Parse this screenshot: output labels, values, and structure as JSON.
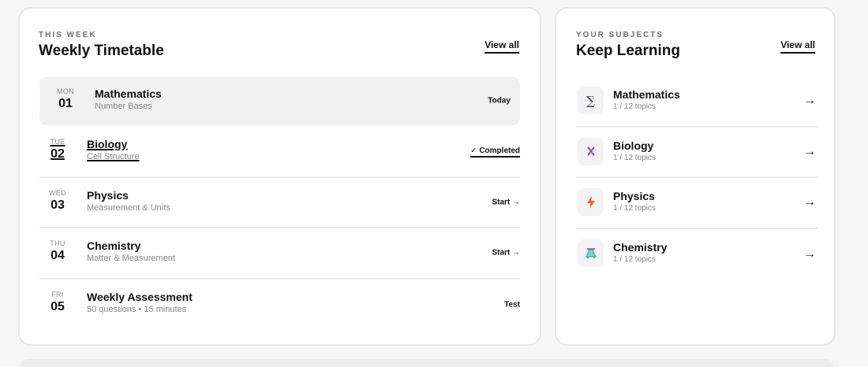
{
  "timetable": {
    "eyebrow": "THIS WEEK",
    "title": "Weekly Timetable",
    "view_all": "View all",
    "rows": [
      {
        "dow": "MON",
        "num": "01",
        "subject": "Mathematics",
        "topic": "Number Bases",
        "action": "Today"
      },
      {
        "dow": "TUE",
        "num": "02",
        "subject": "Biology",
        "topic": "Cell Structure",
        "action": "✓ Completed"
      },
      {
        "dow": "WED",
        "num": "03",
        "subject": "Physics",
        "topic": "Measurement & Units",
        "action": "Start →"
      },
      {
        "dow": "THU",
        "num": "04",
        "subject": "Chemistry",
        "topic": "Matter & Measurement",
        "action": "Start →"
      },
      {
        "dow": "FRI",
        "num": "05",
        "subject": "Weekly Assessment",
        "topic": "50 questions • 15 minutes",
        "action": "Test"
      }
    ]
  },
  "subjects": {
    "eyebrow": "YOUR SUBJECTS",
    "title": "Keep Learning",
    "view_all": "View all",
    "items": [
      {
        "icon_name": "sigma-icon",
        "icon_glyph": "∑",
        "icon_color": "#333333",
        "name": "Mathematics",
        "progress": "1 / 12 topics",
        "arrow": "→"
      },
      {
        "icon_name": "dna-icon",
        "icon_glyph": "🧬",
        "icon_color": "#c03a8c",
        "name": "Biology",
        "progress": "1 / 12 topics",
        "arrow": "→"
      },
      {
        "icon_name": "lightning-icon",
        "icon_glyph": "⚡",
        "icon_color": "#f0642c",
        "name": "Physics",
        "progress": "1 / 12 topics",
        "arrow": "→"
      },
      {
        "icon_name": "flask-icon",
        "icon_glyph": "⚗",
        "icon_color": "#2f9e8f",
        "name": "Chemistry",
        "progress": "1 / 12 topics",
        "arrow": "→"
      }
    ]
  }
}
